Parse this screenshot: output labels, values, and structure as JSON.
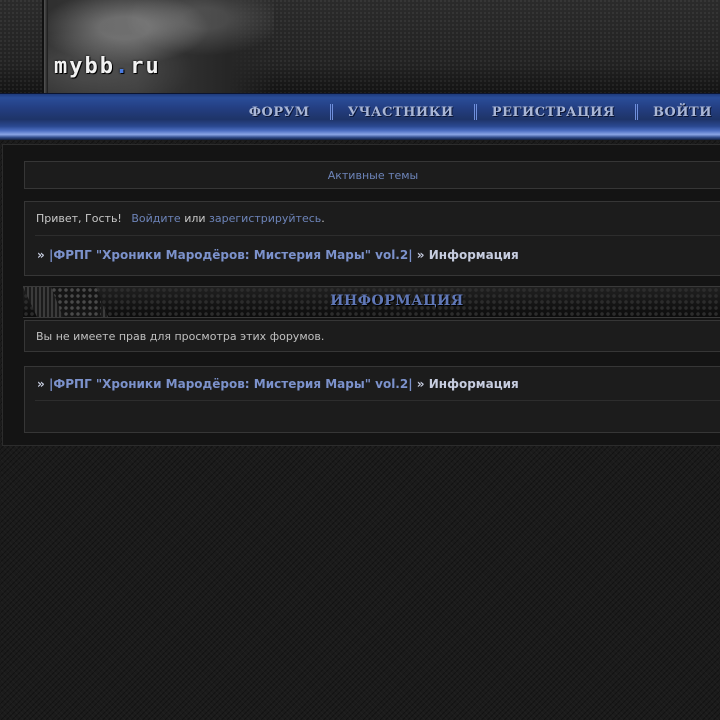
{
  "header": {
    "logo_text": "mybb",
    "logo_dot": ".",
    "logo_tld": "ru"
  },
  "nav": {
    "items": [
      {
        "label": "ФОРУМ"
      },
      {
        "label": "УЧАСТНИКИ"
      },
      {
        "label": "РЕГИСТРАЦИЯ"
      },
      {
        "label": "ВОЙТИ"
      }
    ]
  },
  "active_topics": {
    "label": "Активные темы"
  },
  "welcome": {
    "greeting": "Привет, Гость!",
    "login_link": "Войдите",
    "or": "или",
    "register_link": "зарегистрируйтесь",
    "period": "."
  },
  "breadcrumb": {
    "arrow": "»",
    "forum_link": "|ФРПГ \"Хроники Мародёров: Мистерия Мары\" vol.2|",
    "separator": "»",
    "current": "Информация"
  },
  "section": {
    "title": "ИНФОРМАЦИЯ"
  },
  "message": {
    "text": "Вы не имеете прав для просмотра этих форумов."
  },
  "colors": {
    "accent": "#6d84b9",
    "nav_blue": "#2a4d99",
    "background": "#1b1b1b"
  }
}
